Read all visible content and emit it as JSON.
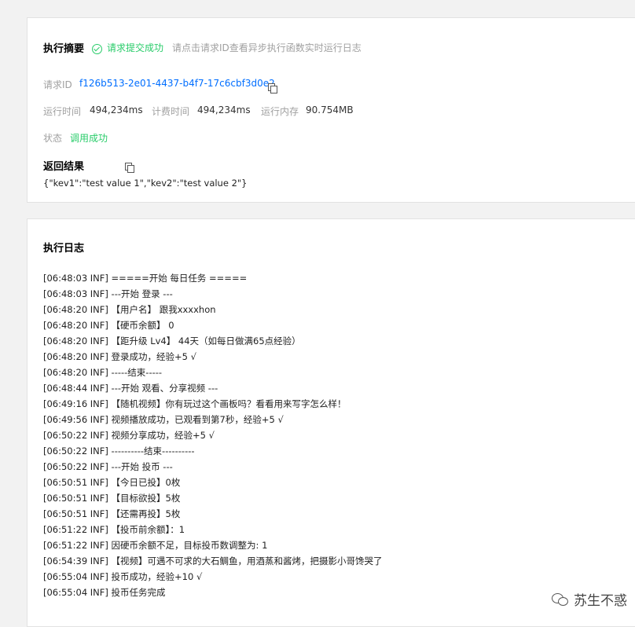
{
  "summary": {
    "title": "执行摘要",
    "submit_status": "请求提交成功",
    "hint": "请点击请求ID查看异步执行函数实时运行日志",
    "request_id_label": "请求ID",
    "request_id": "f126b513-2e01-4437-b4f7-17c6cbf3d0e2",
    "run_time_label": "运行时间",
    "run_time": "494,234ms",
    "billing_time_label": "计费时间",
    "billing_time": "494,234ms",
    "memory_label": "运行内存",
    "memory": "90.754MB",
    "state_label": "状态",
    "state": "调用成功",
    "result_title": "返回结果",
    "result": "{\"kev1\":\"test value 1\",\"kev2\":\"test value 2\"}"
  },
  "log": {
    "title": "执行日志",
    "lines": [
      "[06:48:03 INF] =====开始 每日任务 =====",
      "[06:48:03 INF] ---开始 登录 ---",
      "[06:48:20 INF] 【用户名】 跟我xxxxhon",
      "[06:48:20 INF] 【硬币余额】 0",
      "[06:48:20 INF] 【距升级 Lv4】 44天（如每日做满65点经验）",
      "[06:48:20 INF] 登录成功，经验+5 √",
      "[06:48:20 INF] -----结束-----",
      "[06:48:44 INF] ---开始 观看、分享视频 ---",
      "[06:49:16 INF] 【随机视频】你有玩过这个画板吗？看看用来写字怎么样！",
      "[06:49:56 INF] 视频播放成功，已观看到第7秒，经验+5 √",
      "[06:50:22 INF] 视频分享成功，经验+5 √",
      "[06:50:22 INF] ----------结束----------",
      "[06:50:22 INF] ---开始 投币 ---",
      "[06:50:51 INF] 【今日已投】0枚",
      "[06:50:51 INF] 【目标欲投】5枚",
      "[06:50:51 INF] 【还需再投】5枚",
      "[06:51:22 INF] 【投币前余额】：1",
      "[06:51:22 INF] 因硬币余额不足，目标投币数调整为: 1",
      "[06:54:39 INF] 【视频】可遇不可求的大石鲷鱼，用酒蒸和酱烤，把摄影小哥馋哭了",
      "[06:55:04 INF] 投币成功，经验+10 √",
      "[06:55:04 INF] 投币任务完成"
    ]
  },
  "watermark": {
    "text": "苏生不惑",
    "icon": "wechat-icon"
  }
}
